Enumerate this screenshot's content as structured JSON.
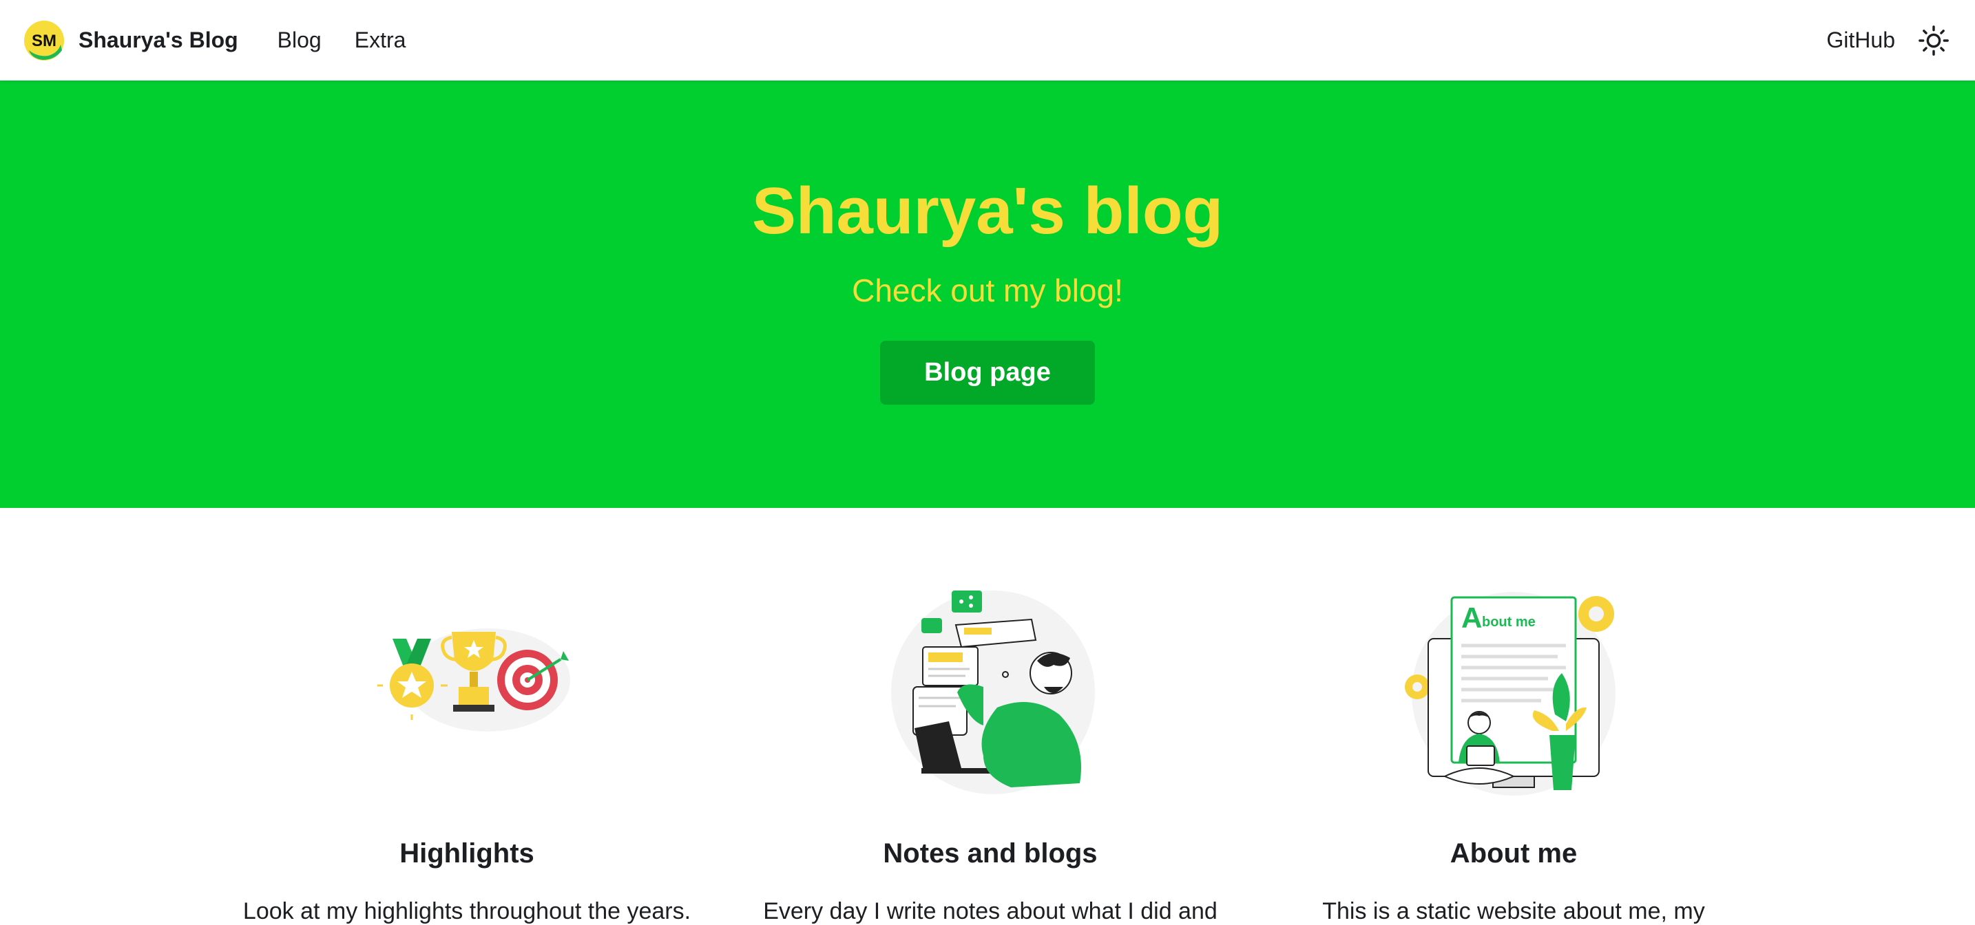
{
  "navbar": {
    "brand_title": "Shaurya's Blog",
    "logo_text": "SM",
    "links": [
      {
        "label": "Blog"
      },
      {
        "label": "Extra"
      }
    ],
    "github_label": "GitHub",
    "theme_icon": "sun-icon"
  },
  "hero": {
    "title": "Shaurya's blog",
    "subtitle": "Check out my blog!",
    "button_label": "Blog page"
  },
  "features": [
    {
      "title": "Highlights",
      "text": "Look at my highlights throughout the years.",
      "icon": "trophy-medal-target-illustration"
    },
    {
      "title": "Notes and blogs",
      "text": "Every day I write notes about what I did and",
      "icon": "person-with-notes-illustration"
    },
    {
      "title": "About me",
      "text": "This is a static website about me, my",
      "icon": "about-me-document-illustration"
    }
  ],
  "colors": {
    "hero_bg": "#00cf30",
    "hero_text": "#f7dd3a",
    "button_bg": "#02a828",
    "accent_green": "#1db954",
    "accent_yellow": "#f7d23a"
  }
}
